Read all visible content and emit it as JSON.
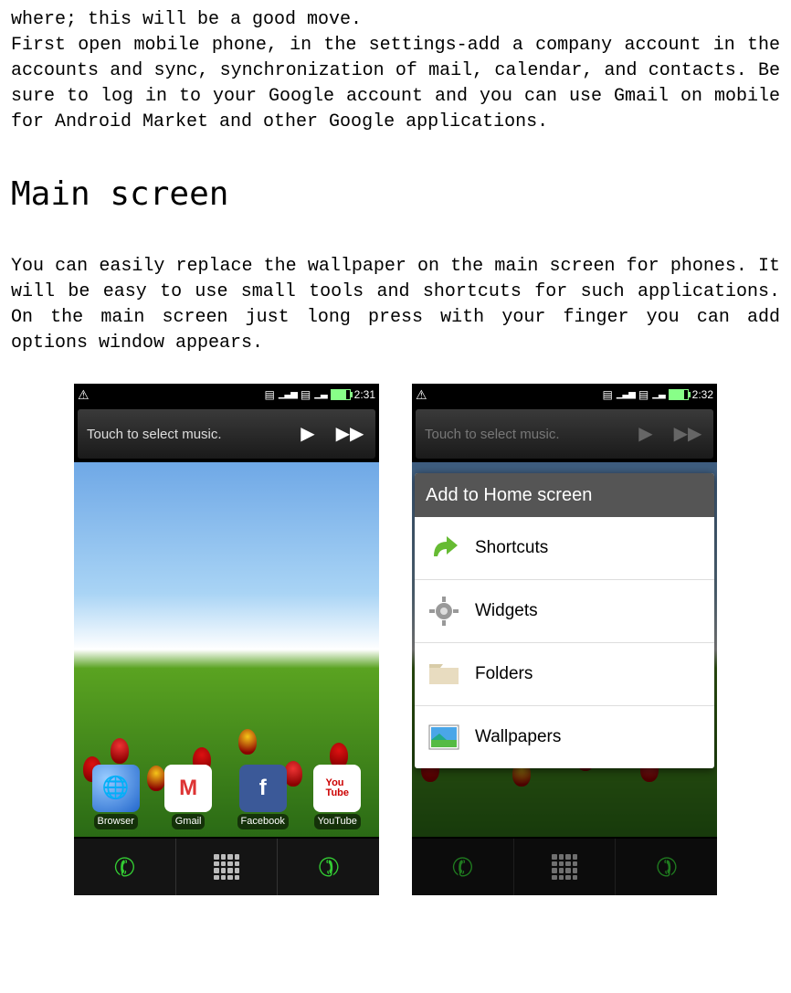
{
  "intro_paragraph": "where; this will be a good move.\nFirst open mobile phone, in the settings-add a company account in the accounts and sync, synchronization of mail, calendar, and contacts.  Be sure to log in to your Google account and you can use Gmail on mobile for Android Market and other Google applications.",
  "heading": "Main screen",
  "body_paragraph": "You can easily replace the wallpaper on the main screen for phones. It will be easy to use small tools and shortcuts for such applications. On the main screen just long press with your finger you can add options window appears.",
  "phone1": {
    "time": "2:31",
    "music_text": "Touch to select music.",
    "apps": [
      {
        "label": "Browser"
      },
      {
        "label": "Gmail"
      },
      {
        "label": "Facebook"
      },
      {
        "label": "YouTube"
      }
    ]
  },
  "phone2": {
    "time": "2:32",
    "music_text": "Touch to select music.",
    "dialog_title": "Add to Home screen",
    "dialog_items": [
      {
        "label": "Shortcuts"
      },
      {
        "label": "Widgets"
      },
      {
        "label": "Folders"
      },
      {
        "label": "Wallpapers"
      }
    ]
  }
}
